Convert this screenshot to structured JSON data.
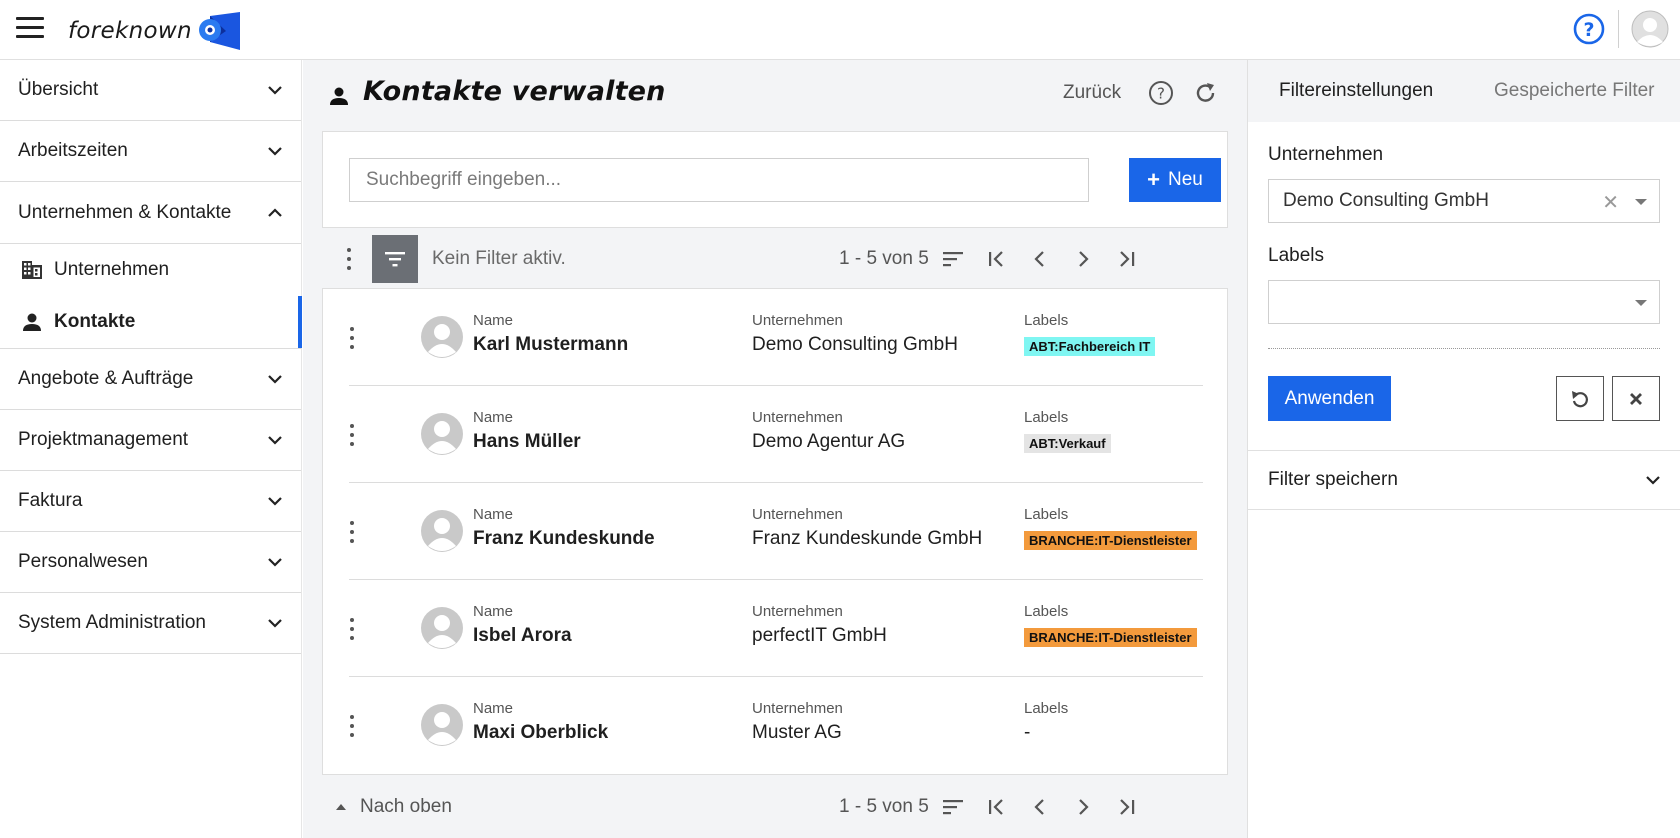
{
  "app": {
    "logo_text": "foreknown"
  },
  "sidebar": {
    "groups_top": [
      {
        "label": "Übersicht",
        "expanded": false
      },
      {
        "label": "Arbeitszeiten",
        "expanded": false
      },
      {
        "label": "Unternehmen & Kontakte",
        "expanded": true
      }
    ],
    "subitems": [
      {
        "label": "Unternehmen",
        "icon": "building-icon",
        "active": false
      },
      {
        "label": "Kontakte",
        "icon": "person-icon",
        "active": true
      }
    ],
    "groups_bottom": [
      {
        "label": "Angebote & Aufträge"
      },
      {
        "label": "Projektmanagement"
      },
      {
        "label": "Faktura"
      },
      {
        "label": "Personalwesen"
      },
      {
        "label": "System Administration"
      }
    ]
  },
  "main": {
    "title": "Kontakte verwalten",
    "back_label": "Zurück",
    "search_placeholder": "Suchbegriff eingeben...",
    "new_label": "Neu",
    "filter_status": "Kein Filter aktiv.",
    "pagination": "1 - 5 von 5",
    "to_top_label": "Nach oben",
    "col_labels": {
      "name": "Name",
      "company": "Unternehmen",
      "labels": "Labels"
    },
    "contacts": [
      {
        "name": "Karl Mustermann",
        "company": "Demo Consulting GmbH",
        "label": "ABT:Fachbereich IT",
        "label_color": "#7ff6f2"
      },
      {
        "name": "Hans Müller",
        "company": "Demo Agentur AG",
        "label": "ABT:Verkauf",
        "label_color": "#e4e4e4"
      },
      {
        "name": "Franz Kundeskunde",
        "company": "Franz Kundeskunde GmbH",
        "label": "BRANCHE:IT-Dienstleister",
        "label_color": "#f39a3c"
      },
      {
        "name": "Isbel Arora",
        "company": "perfectIT GmbH",
        "label": "BRANCHE:IT-Dienstleister",
        "label_color": "#f39a3c"
      },
      {
        "name": "Maxi Oberblick",
        "company": "Muster AG",
        "label": "-",
        "label_color": ""
      }
    ]
  },
  "filter_panel": {
    "tab_settings": "Filtereinstellungen",
    "tab_saved": "Gespeicherte Filter",
    "company_label": "Unternehmen",
    "company_value": "Demo Consulting GmbH",
    "labels_label": "Labels",
    "labels_value": "",
    "apply_label": "Anwenden",
    "save_filter_label": "Filter speichern"
  },
  "colors": {
    "accent": "#1a66e8"
  }
}
